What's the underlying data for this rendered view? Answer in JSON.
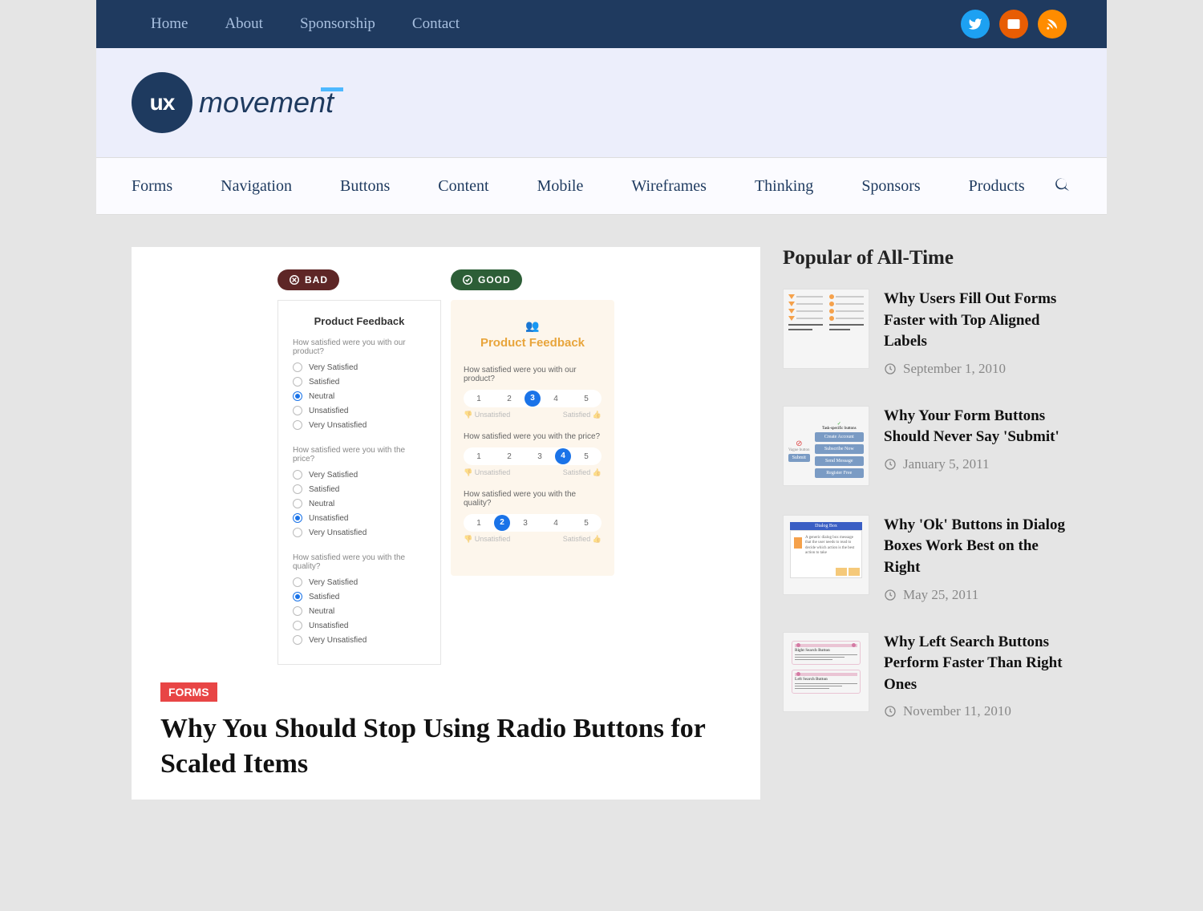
{
  "topnav": [
    "Home",
    "About",
    "Sponsorship",
    "Contact"
  ],
  "logo": {
    "badge": "ux",
    "word": "movement"
  },
  "catnav": [
    "Forms",
    "Navigation",
    "Buttons",
    "Content",
    "Mobile",
    "Wireframes",
    "Thinking",
    "Sponsors",
    "Products"
  ],
  "hero": {
    "bad_label": "BAD",
    "good_label": "GOOD",
    "bad": {
      "title": "Product Feedback",
      "questions": [
        {
          "q": "How satisfied were you with our product?",
          "options": [
            "Very Satisfied",
            "Satisfied",
            "Neutral",
            "Unsatisfied",
            "Very Unsatisfied"
          ],
          "selected": 2
        },
        {
          "q": "How satisfied were you with the price?",
          "options": [
            "Very Satisfied",
            "Satisfied",
            "Neutral",
            "Unsatisfied",
            "Very Unsatisfied"
          ],
          "selected": 3
        },
        {
          "q": "How satisfied were you with the quality?",
          "options": [
            "Very Satisfied",
            "Satisfied",
            "Neutral",
            "Unsatisfied",
            "Very Unsatisfied"
          ],
          "selected": 1
        }
      ]
    },
    "good": {
      "title": "Product Feedback",
      "questions": [
        {
          "q": "How satisfied were you with our product?",
          "n": 5,
          "selected": 3,
          "low": "Unsatisfied",
          "high": "Satisfied"
        },
        {
          "q": "How satisfied were you with the price?",
          "n": 5,
          "selected": 4,
          "low": "Unsatisfied",
          "high": "Satisfied"
        },
        {
          "q": "How satisfied were you with the quality?",
          "n": 5,
          "selected": 2,
          "low": "Unsatisfied",
          "high": "Satisfied"
        }
      ]
    }
  },
  "article": {
    "category": "FORMS",
    "title": "Why You Should Stop Using Radio Buttons for Scaled Items"
  },
  "sidebar": {
    "heading": "Popular of All-Time",
    "items": [
      {
        "title": "Why Users Fill Out Forms Faster with Top Aligned Labels",
        "date": "September 1, 2010"
      },
      {
        "title": "Why Your Form Buttons Should Never Say 'Submit'",
        "date": "January 5, 2011"
      },
      {
        "title": "Why 'Ok' Buttons in Dialog Boxes Work Best on the Right",
        "date": "May 25, 2011"
      },
      {
        "title": "Why Left Search Buttons Perform Faster Than Right Ones",
        "date": "November 11, 2010"
      }
    ]
  }
}
